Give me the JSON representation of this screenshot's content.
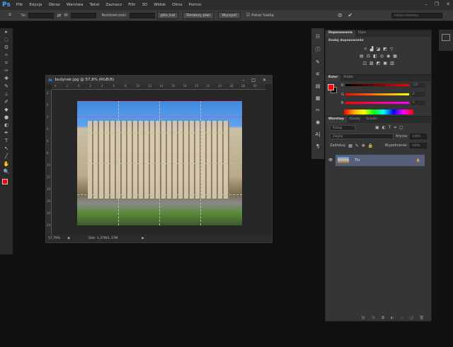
{
  "app": {
    "logo": "Ps"
  },
  "menu": [
    "Plik",
    "Edycja",
    "Obraz",
    "Warstwa",
    "Tekst",
    "Zaznacz",
    "Filtr",
    "3D",
    "Widok",
    "Okno",
    "Pomoc"
  ],
  "window_controls": [
    "–",
    "❐",
    "✕"
  ],
  "options": {
    "s_label": "Sz:",
    "w_label": "W:",
    "resolution_label": "Rozdzielczość:",
    "unit": "piks./cal",
    "front_button": "Pierwszy plan",
    "clear_button": "Wyczyść",
    "grid_label": "Pokaż Siatkę",
    "grid_checked": true,
    "workspace": "Istotne elementy"
  },
  "tools": [
    "▸",
    "◌",
    "ʘ",
    "✧",
    "⌗",
    "✑",
    "✚",
    "✎",
    "⊥",
    "✐",
    "◆",
    "●",
    "◐",
    "✒",
    "T",
    "↖",
    "╱",
    "✋",
    "🔍"
  ],
  "colors": {
    "foreground": "#ff0000",
    "background": "#000000",
    "accent": "#4aa3ff"
  },
  "document": {
    "title": "budynek.jpg @ 57,8% (RGB/8)",
    "ruler_top": [
      "4",
      "2",
      "0",
      "2",
      "4",
      "6",
      "8",
      "10",
      "12",
      "14",
      "16",
      "18",
      "20",
      "22",
      "24",
      "26",
      "28",
      "30"
    ],
    "ruler_left": [
      "2",
      "0",
      "2",
      "4",
      "6",
      "8",
      "10",
      "12",
      "14",
      "16",
      "18",
      "20"
    ],
    "zoom": "57,79%",
    "doc_info": "Dok: 1,37M/1,37M"
  },
  "adjustments": {
    "tabs": [
      "Dopasowania",
      "Style"
    ],
    "title": "Dodaj dopasowanie",
    "rows": [
      [
        "☼",
        "▟",
        "◪",
        "◩",
        "▽"
      ],
      [
        "▤",
        "⚖",
        "◧",
        "◎",
        "◉",
        "▦"
      ],
      [
        "◫",
        "▨",
        "◩",
        "▣",
        "▥"
      ]
    ]
  },
  "color_panel": {
    "tabs": [
      "Kolor",
      "Próbki"
    ],
    "channels": [
      {
        "label": "R",
        "value": "255"
      },
      {
        "label": "G",
        "value": "0"
      },
      {
        "label": "B",
        "value": "0"
      }
    ]
  },
  "layers_panel": {
    "tabs": [
      "Warstwy",
      "Kanały",
      "Ścieżki"
    ],
    "filter": "Rodzaj",
    "blend_mode": "Zwykły",
    "opacity_label": "Krycie:",
    "opacity": "100%",
    "lock_label": "Zablokuj:",
    "fill_label": "Wypełnienie:",
    "fill": "100%",
    "layers": [
      {
        "name": "Tło",
        "visible": true,
        "locked": true
      }
    ],
    "footer_icons": [
      "⛓",
      "fx",
      "◘",
      "◐",
      "▭",
      "❏",
      "🗑"
    ]
  }
}
